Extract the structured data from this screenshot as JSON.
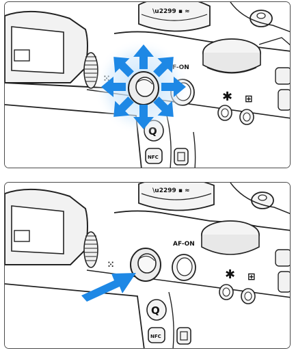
{
  "labels": {
    "af_on": "AF-ON",
    "asterisk": "✱",
    "grid_button": "⊞",
    "magnify": "Q",
    "nfc": "NFC",
    "mic_holes": "⁙"
  },
  "colors": {
    "arrow_blue": "#1e88e5",
    "glow_blue": "#bfe0fb",
    "line": "#222222",
    "gray_fill": "#ececec"
  },
  "icons": [
    "asterisk-icon",
    "magnify-icon",
    "grid-icon",
    "nfc-icon",
    "arrow-icon"
  ]
}
